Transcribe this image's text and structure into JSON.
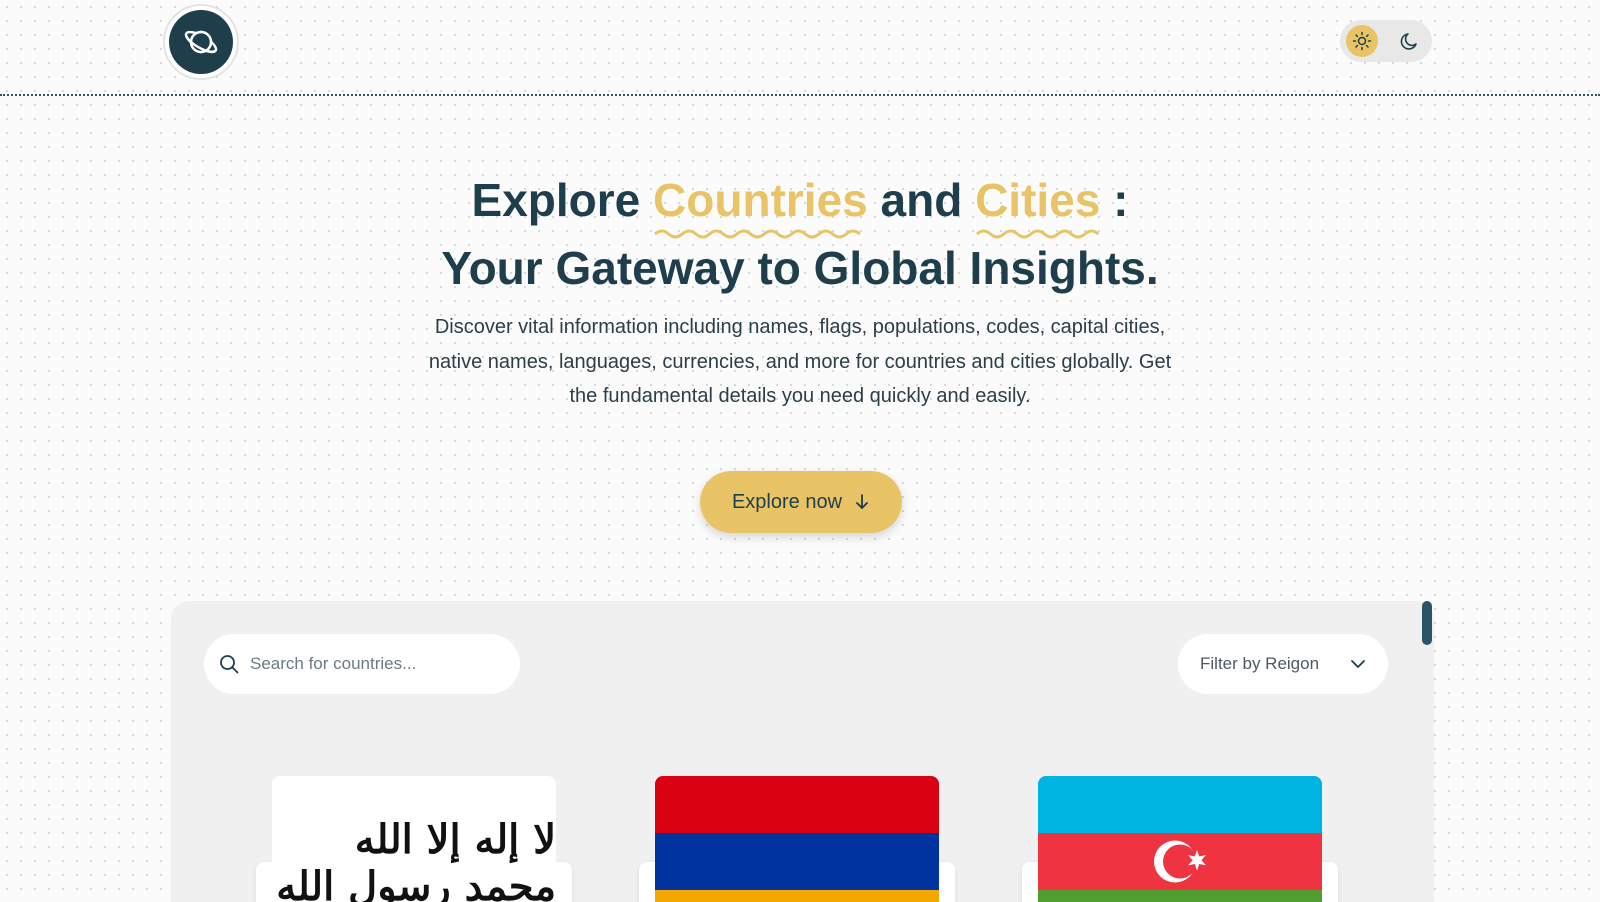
{
  "header": {
    "logo_icon": "planet-icon",
    "theme": {
      "light_icon": "sun-icon",
      "dark_icon": "moon-icon",
      "active": "light"
    }
  },
  "hero": {
    "title_word_explore": "Explore",
    "title_accent_1": "Countries",
    "title_word_and": "and",
    "title_accent_2": "Cities",
    "title_colon": ":",
    "title_line_2": "Your Gateway to Global Insights.",
    "description": "Discover vital information including names, flags, populations, codes, capital cities, native names, languages, currencies, and more for countries and cities globally. Get the fundamental details you need quickly and easily.",
    "cta_label": "Explore now",
    "cta_icon": "arrow-down-icon"
  },
  "panel": {
    "search_placeholder": "Search for countries...",
    "search_icon": "search-icon",
    "filter_label": "Filter by Reigon",
    "filter_icon": "chevron-down-icon"
  },
  "countries": [
    {
      "flag": "afghanistan-flag",
      "flag_text": "لا إله إلا الله محمد رسول الله"
    },
    {
      "flag": "armenia-flag",
      "stripes": [
        "#d90012",
        "#0033a0",
        "#f2a800"
      ]
    },
    {
      "flag": "azerbaijan-flag",
      "stripes": [
        "#00b5e2",
        "#ef3340",
        "#509e2f"
      ]
    }
  ],
  "colors": {
    "accent": "#e8c466",
    "primary": "#1f3e4c",
    "panel": "#f0f0f0"
  }
}
